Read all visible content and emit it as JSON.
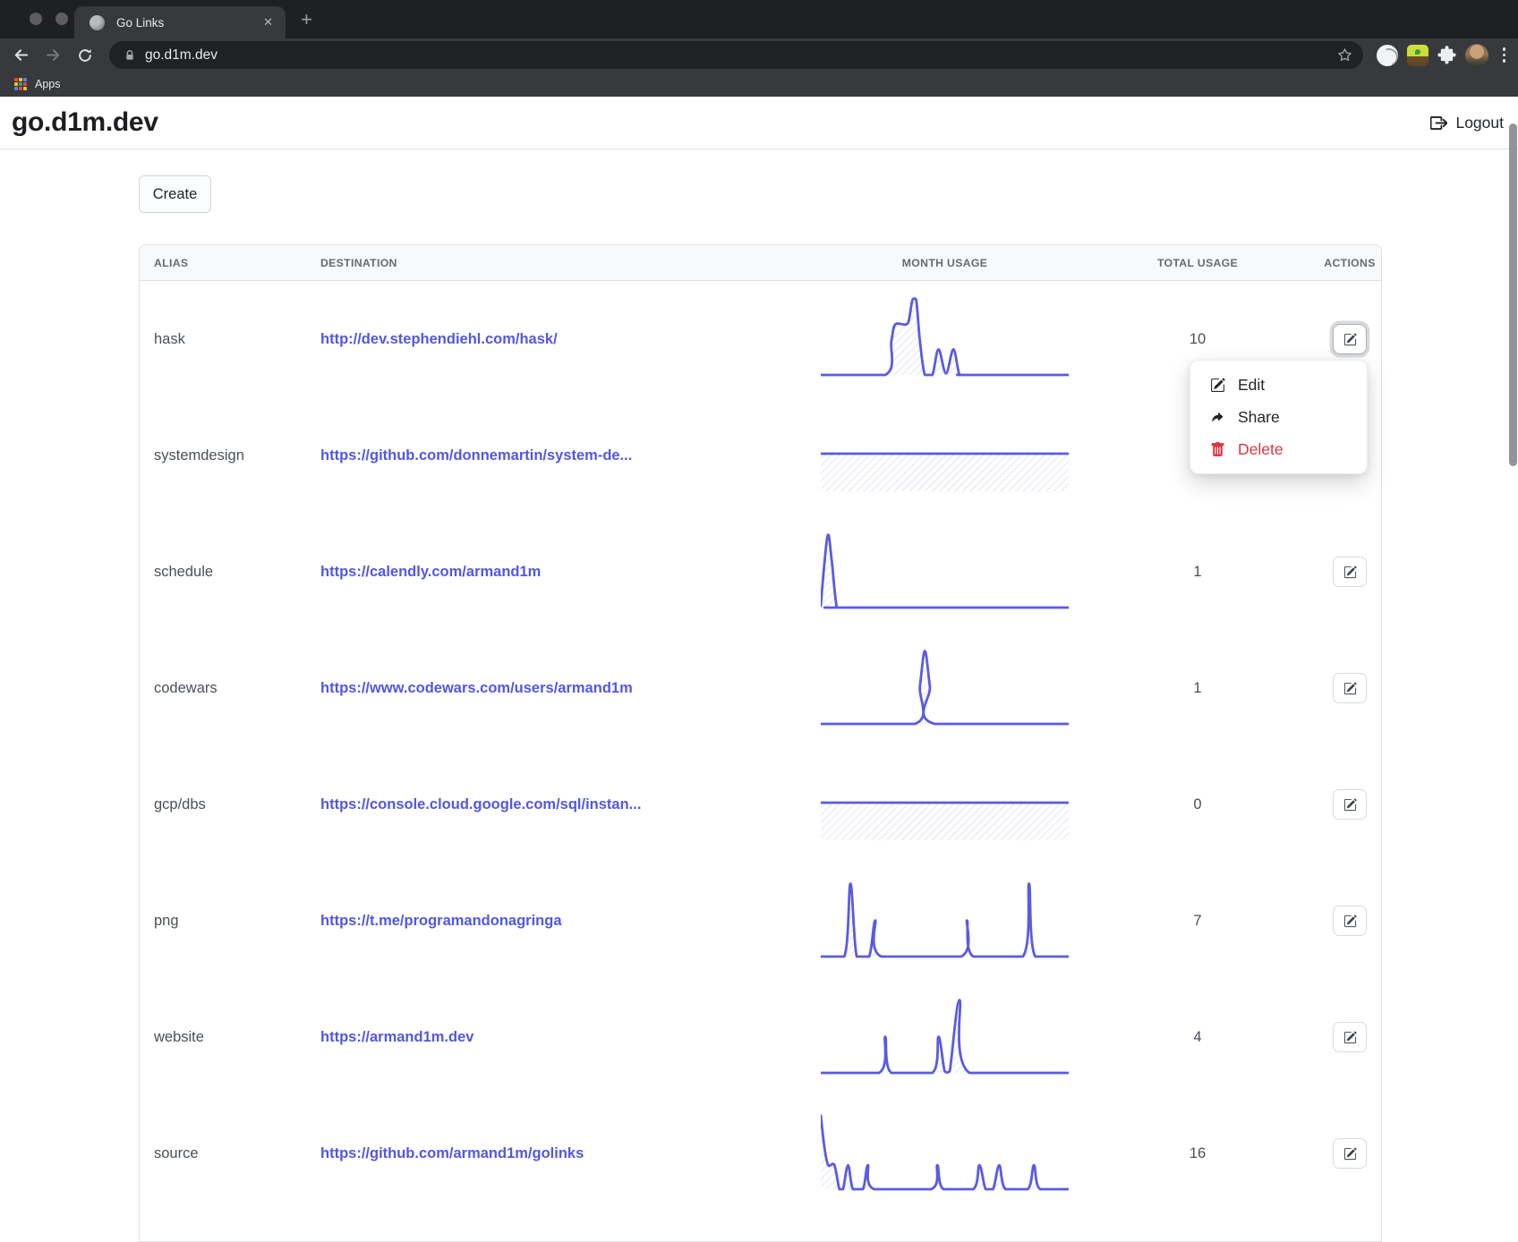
{
  "browser": {
    "tab": {
      "title": "Go Links"
    },
    "url": "go.d1m.dev",
    "bookmarks": {
      "apps_label": "Apps"
    }
  },
  "header": {
    "title": "go.d1m.dev",
    "logout_label": "Logout"
  },
  "toolbar": {
    "create_label": "Create"
  },
  "table": {
    "columns": [
      "ALIAS",
      "DESTINATION",
      "MONTH USAGE",
      "TOTAL USAGE",
      "ACTIONS"
    ],
    "rows": [
      {
        "alias": "hask",
        "destination": "http://dev.stephendiehl.com/hask/",
        "total": "10",
        "action_focused": true
      },
      {
        "alias": "systemdesign",
        "destination": "https://github.com/donnemartin/system-de...",
        "total": null,
        "action_focused": false
      },
      {
        "alias": "schedule",
        "destination": "https://calendly.com/armand1m",
        "total": "1",
        "action_focused": false
      },
      {
        "alias": "codewars",
        "destination": "https://www.codewars.com/users/armand1m",
        "total": "1",
        "action_focused": false
      },
      {
        "alias": "gcp/dbs",
        "destination": "https://console.cloud.google.com/sql/instan...",
        "total": "0",
        "action_focused": false
      },
      {
        "alias": "png",
        "destination": "https://t.me/programandonagringa",
        "total": "7",
        "action_focused": false
      },
      {
        "alias": "website",
        "destination": "https://armand1m.dev",
        "total": "4",
        "action_focused": false
      },
      {
        "alias": "source",
        "destination": "https://github.com/armand1m/golinks",
        "total": "16",
        "action_focused": false
      }
    ]
  },
  "menu": {
    "items": [
      {
        "label": "Edit"
      },
      {
        "label": "Share"
      },
      {
        "label": "Delete",
        "danger": true
      }
    ]
  },
  "chart_data": [
    {
      "type": "area",
      "series": "hask",
      "x_range": [
        0,
        100
      ],
      "y_range": [
        0,
        100
      ],
      "points": [
        [
          0,
          0
        ],
        [
          26,
          0
        ],
        [
          28.5,
          45
        ],
        [
          30,
          67
        ],
        [
          34,
          67
        ],
        [
          35.5,
          72
        ],
        [
          37,
          100
        ],
        [
          38.5,
          100
        ],
        [
          40,
          45
        ],
        [
          42,
          0
        ],
        [
          45,
          0
        ],
        [
          47.5,
          34
        ],
        [
          50.5,
          2
        ],
        [
          53.5,
          34
        ],
        [
          56,
          0
        ],
        [
          59,
          0
        ],
        [
          100,
          0
        ]
      ]
    },
    {
      "type": "area",
      "series": "systemdesign",
      "x_range": [
        0,
        100
      ],
      "y_range": [
        0,
        100
      ],
      "points": [
        [
          0,
          50
        ],
        [
          100,
          50
        ]
      ]
    },
    {
      "type": "area",
      "series": "schedule",
      "x_range": [
        0,
        100
      ],
      "y_range": [
        0,
        100
      ],
      "points": [
        [
          0,
          2
        ],
        [
          1.5,
          60
        ],
        [
          3,
          97
        ],
        [
          4.5,
          60
        ],
        [
          6.5,
          0
        ],
        [
          9,
          0
        ],
        [
          100,
          0
        ]
      ]
    },
    {
      "type": "area",
      "series": "codewars",
      "x_range": [
        0,
        100
      ],
      "y_range": [
        0,
        100
      ],
      "points": [
        [
          0,
          0
        ],
        [
          38,
          0
        ],
        [
          40,
          50
        ],
        [
          42,
          97
        ],
        [
          44,
          50
        ],
        [
          46,
          0
        ],
        [
          100,
          0
        ]
      ]
    },
    {
      "type": "area",
      "series": "gcp/dbs",
      "x_range": [
        0,
        100
      ],
      "y_range": [
        0,
        100
      ],
      "points": [
        [
          0,
          50
        ],
        [
          100,
          50
        ]
      ]
    },
    {
      "type": "area",
      "series": "png",
      "x_range": [
        0,
        100
      ],
      "y_range": [
        0,
        100
      ],
      "points": [
        [
          0,
          0
        ],
        [
          9.5,
          0
        ],
        [
          12,
          97
        ],
        [
          14.5,
          0
        ],
        [
          19.5,
          0
        ],
        [
          22,
          48
        ],
        [
          24.5,
          0
        ],
        [
          56.5,
          0
        ],
        [
          59,
          48
        ],
        [
          61.5,
          0
        ],
        [
          81.5,
          0
        ],
        [
          84,
          97
        ],
        [
          86.5,
          0
        ],
        [
          100,
          0
        ]
      ]
    },
    {
      "type": "area",
      "series": "website",
      "x_range": [
        0,
        100
      ],
      "y_range": [
        0,
        100
      ],
      "points": [
        [
          0,
          0
        ],
        [
          23.5,
          0
        ],
        [
          26,
          48
        ],
        [
          28.5,
          0
        ],
        [
          45,
          0
        ],
        [
          47.5,
          48
        ],
        [
          50,
          2
        ],
        [
          52,
          2
        ],
        [
          56,
          97
        ],
        [
          60,
          0
        ],
        [
          100,
          0
        ]
      ]
    },
    {
      "type": "area",
      "series": "source",
      "x_range": [
        0,
        100
      ],
      "y_range": [
        0,
        100
      ],
      "points": [
        [
          0,
          98
        ],
        [
          1.5,
          55
        ],
        [
          3,
          32
        ],
        [
          5.5,
          32
        ],
        [
          7.5,
          0
        ],
        [
          9,
          0
        ],
        [
          11,
          32
        ],
        [
          13,
          0
        ],
        [
          17,
          0
        ],
        [
          19,
          32
        ],
        [
          21.5,
          0
        ],
        [
          44.5,
          0
        ],
        [
          47,
          32
        ],
        [
          49.5,
          0
        ],
        [
          61.5,
          0
        ],
        [
          64,
          32
        ],
        [
          66.5,
          0
        ],
        [
          69.5,
          0
        ],
        [
          72,
          32
        ],
        [
          74.5,
          0
        ],
        [
          83.5,
          0
        ],
        [
          86,
          32
        ],
        [
          88.5,
          0
        ],
        [
          100,
          0
        ]
      ]
    }
  ],
  "colors": {
    "link": "#5257e4",
    "sparkline": "#5a5be2",
    "sparkline_hatch": "#cdd0f4",
    "danger": "#dc3545",
    "chrome_dark": "#1f2023",
    "chrome_light": "#38393c"
  }
}
